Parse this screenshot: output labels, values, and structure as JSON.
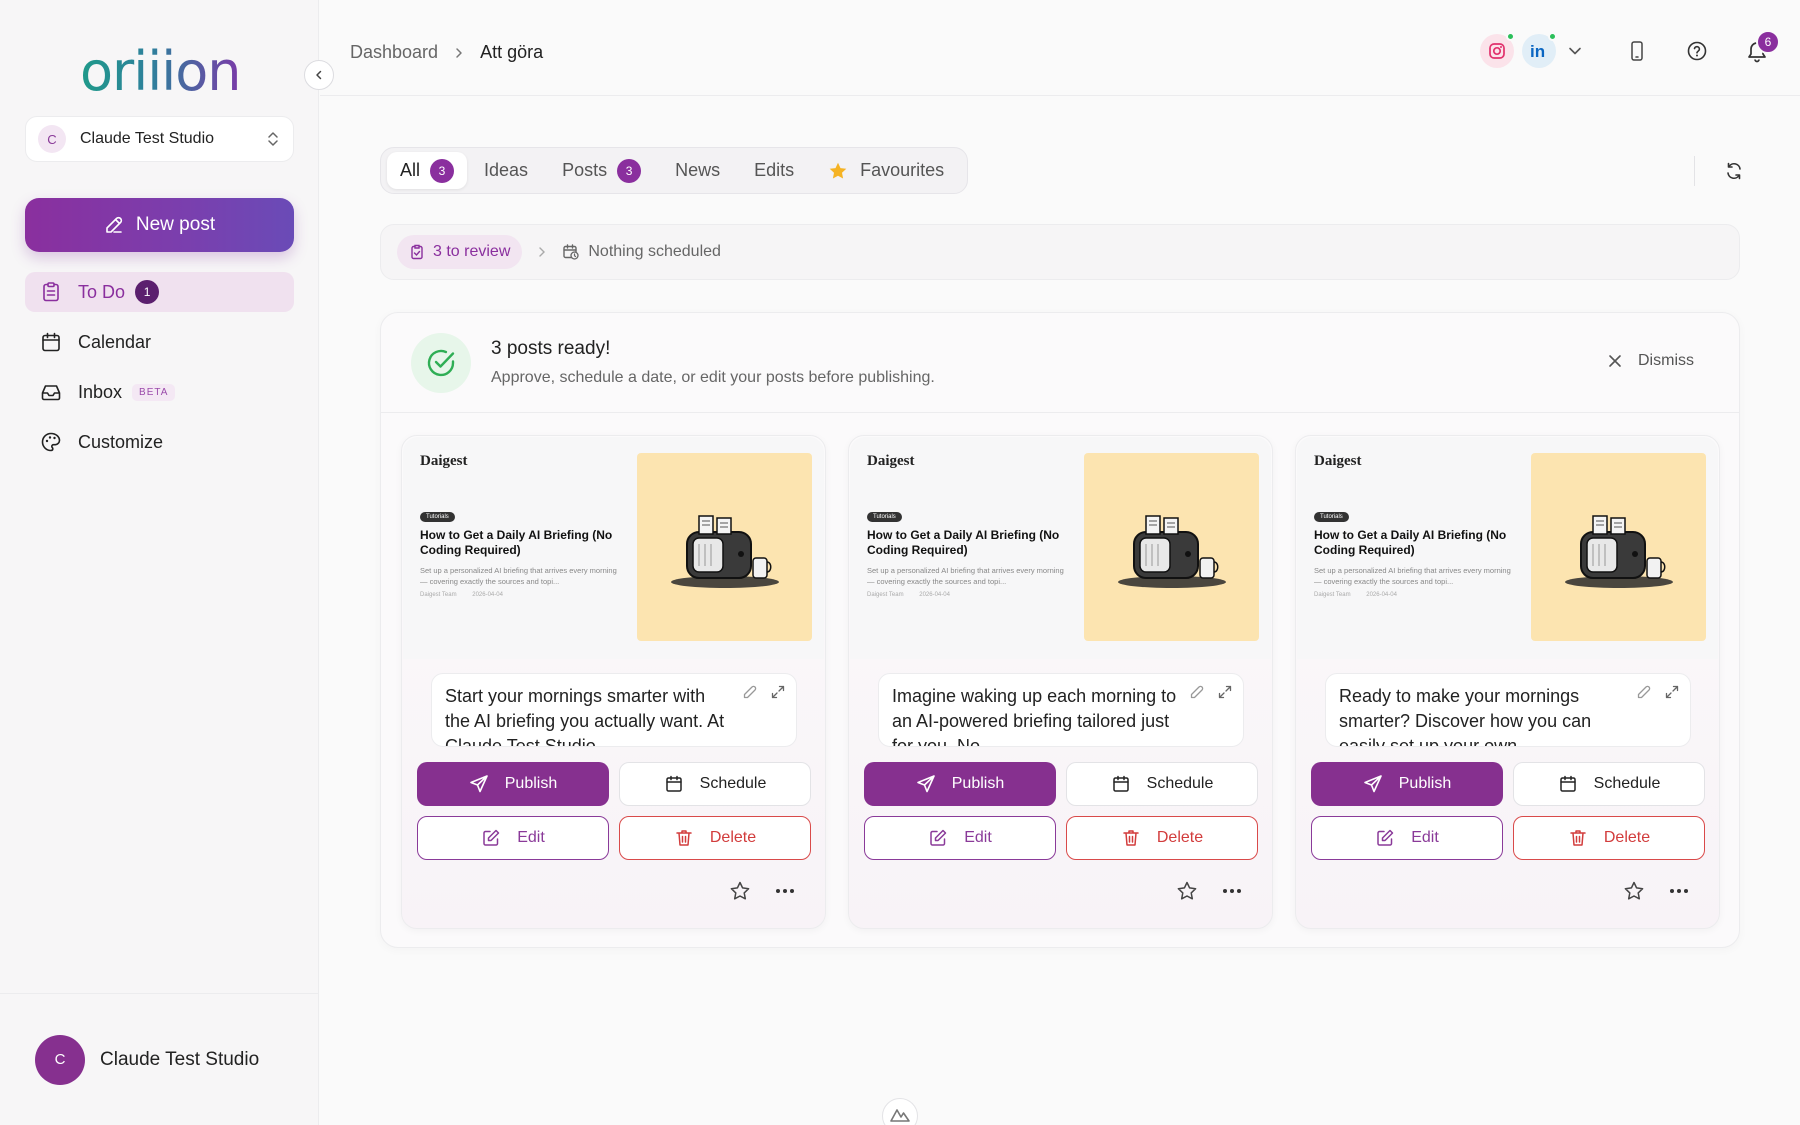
{
  "app": {
    "logo_text": "oriiion",
    "studio_name": "Claude Test Studio",
    "studio_initial": "C"
  },
  "sidebar": {
    "new_post_label": "New post",
    "items": [
      {
        "label": "To Do",
        "icon": "clipboard-icon",
        "badge": "1",
        "active": true
      },
      {
        "label": "Calendar",
        "icon": "calendar-icon"
      },
      {
        "label": "Inbox",
        "icon": "inbox-icon",
        "tag": "BETA"
      },
      {
        "label": "Customize",
        "icon": "palette-icon"
      }
    ],
    "footer_name": "Claude Test Studio",
    "footer_initial": "C"
  },
  "header": {
    "breadcrumb_root": "Dashboard",
    "breadcrumb_current": "Att göra",
    "notification_count": "6",
    "accounts": [
      "instagram-icon",
      "linkedin-icon"
    ]
  },
  "tabs": [
    {
      "label": "All",
      "count": "3",
      "active": true
    },
    {
      "label": "Ideas"
    },
    {
      "label": "Posts",
      "count": "3"
    },
    {
      "label": "News"
    },
    {
      "label": "Edits"
    },
    {
      "label": "Favourites",
      "icon": "star-icon"
    }
  ],
  "status": {
    "review_label": "3 to review",
    "scheduled_label": "Nothing scheduled"
  },
  "panel": {
    "title": "3 posts ready!",
    "subtitle": "Approve, schedule a date, or edit your posts before publishing.",
    "dismiss_label": "Dismiss"
  },
  "buttons": {
    "publish": "Publish",
    "schedule": "Schedule",
    "edit": "Edit",
    "delete": "Delete"
  },
  "article": {
    "brand": "Daigest",
    "tag": "Tutorials",
    "title": "How to Get a Daily AI Briefing (No Coding Required)",
    "description": "Set up a personalized AI briefing that arrives every morning — covering exactly the sources and topi...",
    "author": "Daigest Team",
    "date": "2026-04-04"
  },
  "posts": [
    {
      "caption": "Start your mornings smarter with the AI briefing you actually want. At Claude Test Studio"
    },
    {
      "caption": "Imagine waking up each morning to an AI-powered briefing tailored just for you. No"
    },
    {
      "caption": "Ready to make your mornings smarter? Discover how you can easily set up your own"
    }
  ],
  "colors": {
    "brand_purple": "#86308f",
    "delete_red": "#d23c3c",
    "success_green": "#2fae55",
    "highlight_yellow": "#fce4b0"
  }
}
